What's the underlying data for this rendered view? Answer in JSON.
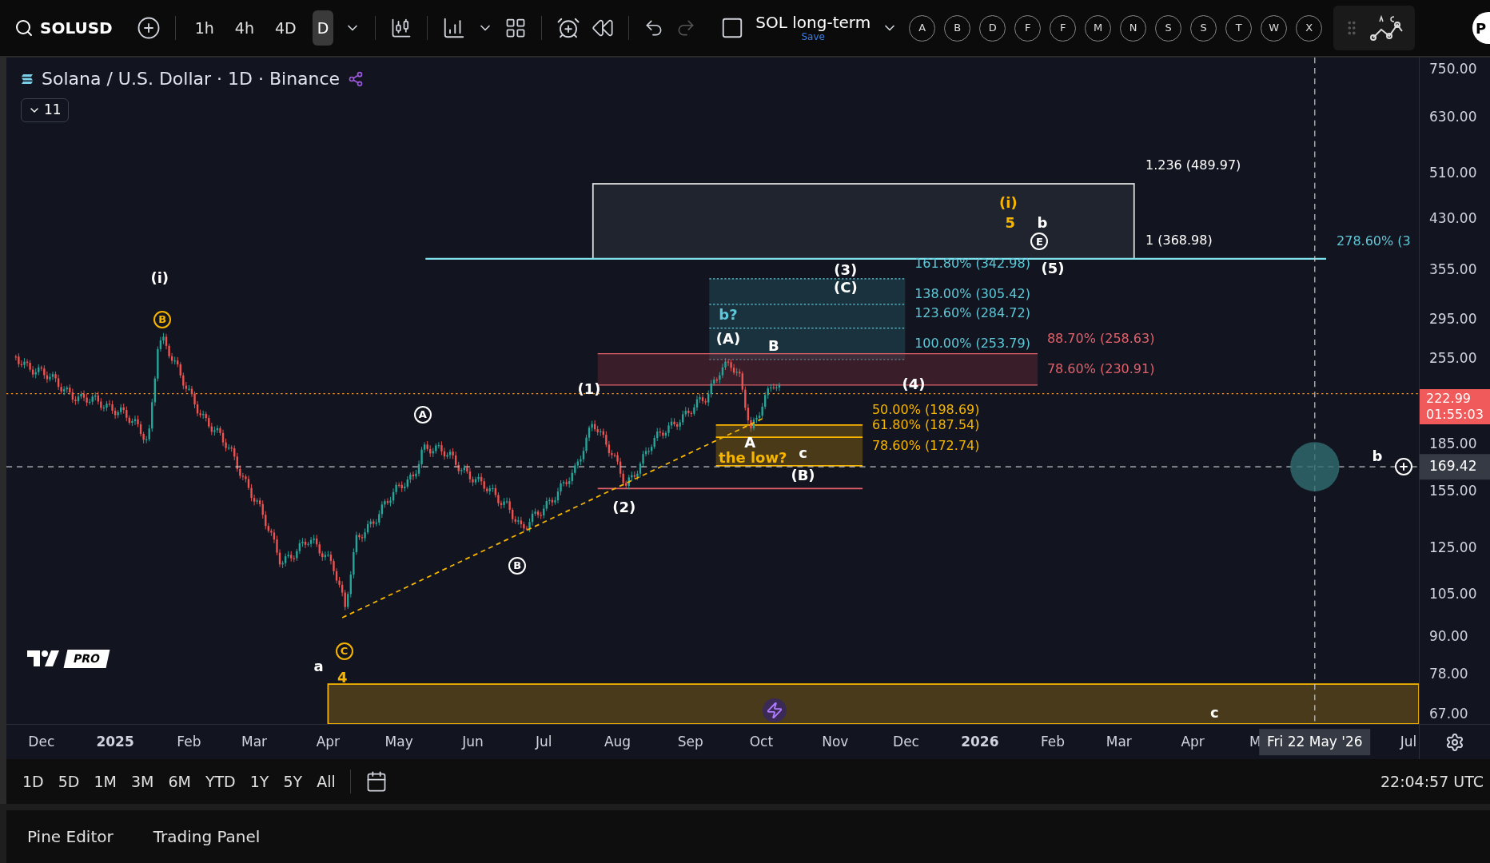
{
  "toolbar": {
    "symbol": "SOLUSD",
    "intervals": [
      {
        "label": "1h",
        "selected": false
      },
      {
        "label": "4h",
        "selected": false
      },
      {
        "label": "4D",
        "selected": false
      },
      {
        "label": "D",
        "selected": true
      }
    ],
    "layout": {
      "name": "SOL long-term",
      "status": "Save"
    },
    "letter_buttons": [
      "A",
      "B",
      "D",
      "F",
      "F",
      "M",
      "N",
      "S",
      "S",
      "T",
      "W",
      "X"
    ],
    "cut_button": "P"
  },
  "legend": {
    "title": "Solana / U.S. Dollar · 1D · Binance",
    "collapse_count": "11"
  },
  "chart": {
    "annotations": [
      {
        "text": "1.236 (489.97)",
        "kind": "level",
        "color": "#ffffff"
      },
      {
        "text": "(i)",
        "kind": "label",
        "color": "#f7b500"
      },
      {
        "text": "5",
        "kind": "label",
        "color": "#f7b500"
      },
      {
        "text": "b",
        "kind": "label",
        "color": "#ffffff"
      },
      {
        "text": "E",
        "kind": "circled",
        "color": "#ffffff"
      },
      {
        "text": "1 (368.98)",
        "kind": "level",
        "color": "#ffffff"
      },
      {
        "text": "278.60% (3",
        "kind": "level",
        "color": "#5ec8d8"
      },
      {
        "text": "(i)",
        "kind": "label",
        "color": "#ffffff"
      },
      {
        "text": "(3)",
        "kind": "label",
        "color": "#ffffff"
      },
      {
        "text": "161.80% (342.98)",
        "kind": "level",
        "color": "#5ec8d8"
      },
      {
        "text": "(5)",
        "kind": "label",
        "color": "#ffffff"
      },
      {
        "text": "(C)",
        "kind": "label",
        "color": "#ffffff"
      },
      {
        "text": "138.00% (305.42)",
        "kind": "level",
        "color": "#5ec8d8"
      },
      {
        "text": "B",
        "kind": "circled",
        "color": "#f7b500"
      },
      {
        "text": "b?",
        "kind": "label",
        "color": "#5ec8d8"
      },
      {
        "text": "123.60% (284.72)",
        "kind": "level",
        "color": "#5ec8d8"
      },
      {
        "text": "(A)",
        "kind": "label",
        "color": "#ffffff"
      },
      {
        "text": "B",
        "kind": "label",
        "color": "#ffffff"
      },
      {
        "text": "100.00% (253.79)",
        "kind": "level",
        "color": "#5ec8d8"
      },
      {
        "text": "88.70% (258.63)",
        "kind": "level",
        "color": "#e0606a"
      },
      {
        "text": "78.60% (230.91)",
        "kind": "level",
        "color": "#e0606a"
      },
      {
        "text": "(1)",
        "kind": "label",
        "color": "#ffffff"
      },
      {
        "text": "(4)",
        "kind": "label",
        "color": "#ffffff"
      },
      {
        "text": "A",
        "kind": "circled",
        "color": "#ffffff"
      },
      {
        "text": "50.00% (198.69)",
        "kind": "level",
        "color": "#f7b500"
      },
      {
        "text": "61.80% (187.54)",
        "kind": "level",
        "color": "#f7b500"
      },
      {
        "text": "A",
        "kind": "label",
        "color": "#ffffff"
      },
      {
        "text": "the low?",
        "kind": "label",
        "color": "#f7b500"
      },
      {
        "text": "c",
        "kind": "label",
        "color": "#ffffff"
      },
      {
        "text": "78.60% (172.74)",
        "kind": "level",
        "color": "#f7b500"
      },
      {
        "text": "b",
        "kind": "label",
        "color": "#ffffff"
      },
      {
        "text": "(B)",
        "kind": "label",
        "color": "#ffffff"
      },
      {
        "text": "(2)",
        "kind": "label",
        "color": "#ffffff"
      },
      {
        "text": "B",
        "kind": "circled",
        "color": "#ffffff"
      },
      {
        "text": "C",
        "kind": "circled",
        "color": "#f7b500"
      },
      {
        "text": "a",
        "kind": "label",
        "color": "#ffffff"
      },
      {
        "text": "4",
        "kind": "label",
        "color": "#f7b500"
      },
      {
        "text": "c",
        "kind": "label",
        "color": "#ffffff"
      }
    ],
    "logo_badge": "PRO",
    "price_axis": {
      "labels": [
        "750.00",
        "630.00",
        "510.00",
        "430.00",
        "355.00",
        "295.00",
        "255.00",
        "185.00",
        "155.00",
        "125.00",
        "105.00",
        "90.00",
        "78.00",
        "67.00"
      ],
      "last_price": "222.99",
      "countdown": "01:55:03",
      "crosshair_price": "169.42"
    },
    "time_axis": {
      "labels": [
        "Dec",
        "2025",
        "Feb",
        "Mar",
        "Apr",
        "May",
        "Jun",
        "Jul",
        "Aug",
        "Sep",
        "Oct",
        "Nov",
        "Dec",
        "2026",
        "Feb",
        "Mar",
        "Apr",
        "M",
        "Jul"
      ],
      "crosshair_date": "Fri 22 May '26"
    }
  },
  "range_bar": {
    "ranges": [
      "1D",
      "5D",
      "1M",
      "3M",
      "6M",
      "YTD",
      "1Y",
      "5Y",
      "All"
    ],
    "clock": "22:04:57 UTC"
  },
  "bottom_panel": {
    "tabs": [
      "Pine Editor",
      "Trading Panel"
    ]
  }
}
